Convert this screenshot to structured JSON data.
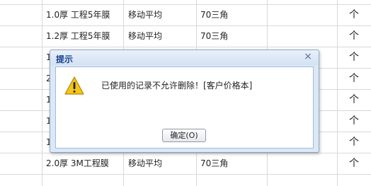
{
  "table": {
    "rows": [
      {
        "spec": "1.0厚 工程5年膜",
        "method": "移动平均",
        "color": "70三角",
        "extra": "",
        "action": "个"
      },
      {
        "spec": "1.2厚 工程5年膜",
        "method": "移动平均",
        "color": "70三角",
        "extra": "",
        "action": "个"
      },
      {
        "spec": "1",
        "method": "",
        "color": "",
        "extra": "",
        "action": "个"
      },
      {
        "spec": "2",
        "method": "",
        "color": "",
        "extra": "",
        "action": "个"
      },
      {
        "spec": "1",
        "method": "",
        "color": "",
        "extra": "",
        "action": "个"
      },
      {
        "spec": "1",
        "method": "",
        "color": "",
        "extra": "",
        "action": "个"
      },
      {
        "spec": "1",
        "method": "",
        "color": "",
        "extra": "",
        "action": "个"
      },
      {
        "spec": "2.0厚 3M工程膜",
        "method": "移动平均",
        "color": "70三角",
        "extra": "",
        "action": "个"
      }
    ]
  },
  "dialog": {
    "title": "提示",
    "close_glyph": "×",
    "icon": "warning-icon",
    "message": "已使用的记录不允许删除！[客户价格本]",
    "ok_label": "确定(O)"
  },
  "colors": {
    "dialog_frame": "#dde8f5",
    "dialog_title": "#15428b",
    "grid_line": "#d9d9d9",
    "warning_yellow": "#f5c518"
  }
}
